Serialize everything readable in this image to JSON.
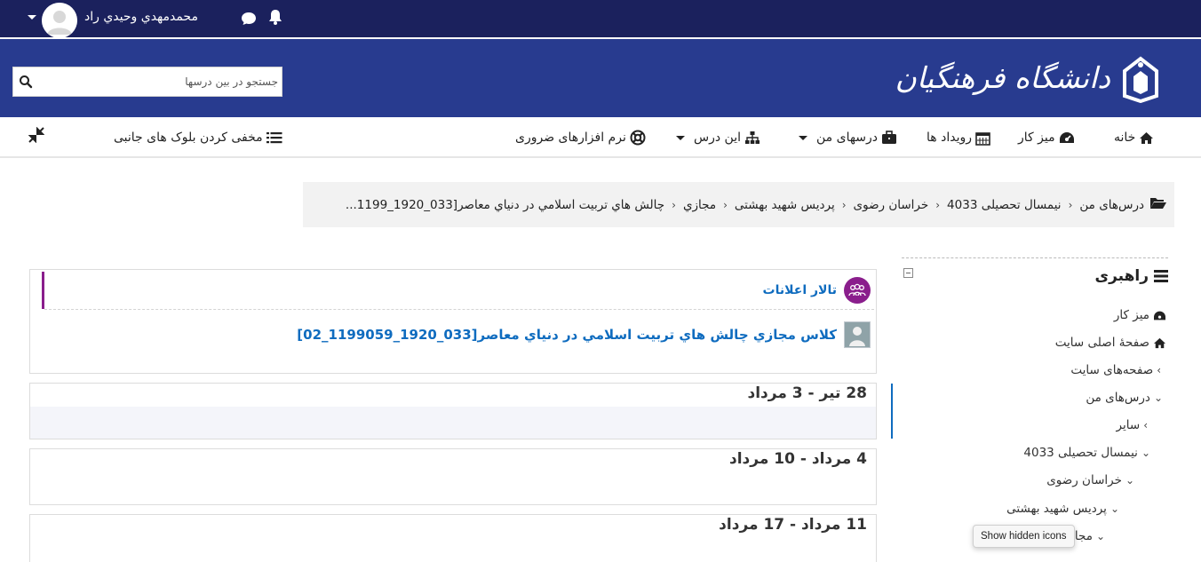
{
  "topbar": {
    "user_name": "محمدمهدي وحيدي راد",
    "icons": [
      "bell-icon",
      "chat-icon",
      "user-menu-caret-icon"
    ]
  },
  "header": {
    "search_placeholder": "جستجو در بين درسها",
    "logo_text": "دانشگاه فرهنگیان",
    "logo_emblem": "university-emblem-icon",
    "colors": {
      "topbar": "#1b215d",
      "header": "#283b8f",
      "link": "#0f6cbf",
      "accent": "#8a1e8c"
    }
  },
  "nav": {
    "items": [
      {
        "label": "خانه",
        "icon": "home-icon"
      },
      {
        "label": "میز کار",
        "icon": "dashboard-icon"
      },
      {
        "label": "رویداد ها",
        "icon": "calendar-icon"
      },
      {
        "label": "درسهای من",
        "icon": "briefcase-icon"
      },
      {
        "label": "این درس",
        "icon": "sitemap-icon"
      },
      {
        "label": "نرم افزارهای ضروری",
        "icon": "lifebuoy-icon"
      }
    ],
    "hide_blocks_label": "مخفی کردن بلوک های جانبی"
  },
  "breadcrumb": {
    "items": [
      "درس‌های من",
      "نیمسال تحصیلی 4033",
      "خراسان رضوی",
      "پردیس شهید بهشتی",
      "مجازي",
      "چالش هاي تربيت اسلامي در دنياي معاصر[033_1920_1199..."
    ]
  },
  "nav_block": {
    "title": "راهبری",
    "items": [
      {
        "label": "میز کار",
        "icon": "dashboard-icon"
      },
      {
        "label": "صفحهٔ اصلی سایت",
        "icon": "home-icon"
      },
      {
        "label": "صفحه‌های سایت",
        "icon": "chevron-left-icon"
      },
      {
        "label": "درس‌های من",
        "icon": "chevron-down-icon"
      },
      {
        "label": "سایر",
        "icon": "chevron-left-icon"
      },
      {
        "label": "نیمسال تحصیلی 4033",
        "icon": "chevron-down-icon"
      },
      {
        "label": "خراسان رضوی",
        "icon": "chevron-down-icon"
      },
      {
        "label": "پردیس شهید بهشتی",
        "icon": "chevron-down-icon"
      },
      {
        "label": "مجا",
        "icon": "chevron-down-icon"
      }
    ],
    "tooltip": "Show hidden icons"
  },
  "main": {
    "forum_label": "تالار اعلانات",
    "class_label": "كلاس مجازي چالش هاي تربيت اسلامي در دنياي معاصر[033_1920_1199059_02]",
    "weeks": [
      "28 تیر - 3 مرداد",
      "4 مرداد - 10 مرداد",
      "11 مرداد - 17 مرداد"
    ]
  }
}
